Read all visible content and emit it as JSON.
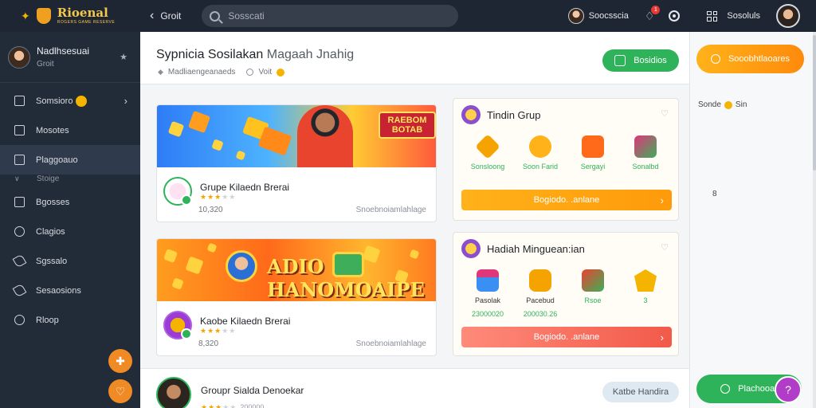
{
  "app": {
    "logo_title": "Rioenal",
    "logo_subtitle": "ROGERS GAME RESERVE"
  },
  "topbar": {
    "back_label": "Groit",
    "search_placeholder": "Sosscati",
    "user_name": "Soocsscia",
    "notif_count": "1",
    "sessions_label": "Sosoluls"
  },
  "sidebar": {
    "profile_name": "Nadlhsesuai",
    "profile_sub": "Groit",
    "items": [
      {
        "label": "Somsioro",
        "icon": "square-icon"
      },
      {
        "label": "Mosotes",
        "icon": "square-icon"
      },
      {
        "label": "Plaggoauo",
        "icon": "bookmark-icon"
      },
      {
        "label": "Stoige",
        "icon": "chevron-down-icon"
      },
      {
        "label": "Bgosses",
        "icon": "square-icon"
      },
      {
        "label": "Clagios",
        "icon": "circle-icon"
      },
      {
        "label": "Sgssalo",
        "icon": "edit-icon"
      },
      {
        "label": "Sesaosions",
        "icon": "tools-icon"
      },
      {
        "label": "Rloop",
        "icon": "gear-icon"
      }
    ]
  },
  "header": {
    "title_bold": "Sypnicia Sosilakan",
    "title_light": "Magaah Jnahig",
    "meta_label": "Madliaengeanaeds",
    "meta_right": "Voit",
    "action_label": "Bosidios"
  },
  "cards": [
    {
      "banner_text": "RAEBOM BOTAB",
      "title": "Grupe Kilaedn Brerai",
      "stars": 3,
      "count": "10,320",
      "cta": "Snoebnoiamlahlage"
    },
    {
      "banner_text": "ADIO HANOMOAIPE",
      "title": "Kaobe Kilaedn Brerai",
      "stars": 3,
      "count": "8,320",
      "cta": "Snoebnoiamlahlage"
    }
  ],
  "groups": [
    {
      "title": "Tindin Grup",
      "rewards": [
        {
          "label": "Sonsloong",
          "color": "#f5a300"
        },
        {
          "label": "Soon Farid",
          "color": "#ff9d1f"
        },
        {
          "label": "Sergayi",
          "color": "#ff6a1a"
        },
        {
          "label": "Sonalbd",
          "color": "#e0367a"
        }
      ],
      "cta": "Bogiodo. .anlane"
    },
    {
      "title": "Hadiah Minguean:ian",
      "rewards": [
        {
          "label": "Pasolak",
          "value": "23000020",
          "color": "#3a8ff2"
        },
        {
          "label": "Pacebud",
          "value": "200030.26",
          "color": "#f5a300"
        },
        {
          "label": "Rsoe",
          "value": "",
          "color": "#e8442e"
        },
        {
          "label": "3",
          "value": "",
          "color": "#f5b400"
        }
      ],
      "cta": "Bogiodo. .anlane"
    }
  ],
  "bottom_row": {
    "title": "Groupr Sialda Denoekar",
    "count": "200000",
    "button": "Katbe Handira"
  },
  "right_panel": {
    "button_top": "Sooobhtlaoares",
    "line_label": "Sonde",
    "line_value": "Sin",
    "num": "8",
    "button_bottom": "Plachooar"
  }
}
